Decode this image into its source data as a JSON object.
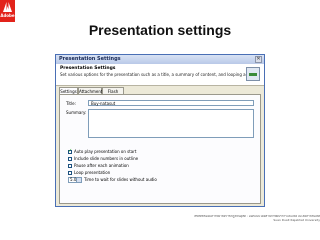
{
  "brand": {
    "logo_text": "Adobe",
    "color": "#e2231a"
  },
  "page": {
    "title": "Presentation settings"
  },
  "dialog": {
    "window_title": "Presentation Settings",
    "close_symbol": "✕",
    "header_title": "Presentation Settings",
    "header_subtitle": "Set various options for the presentation such as a title, a summary of content, and looping action.",
    "tabs": [
      {
        "label": "Settings"
      },
      {
        "label": "Attachments"
      },
      {
        "label": "Flash Files"
      }
    ],
    "title_label": "Title:",
    "title_value": "Buy-natasut",
    "summary_label": "Summary:",
    "summary_value": "",
    "options": [
      {
        "label": "Auto play presentation on start",
        "checked": true
      },
      {
        "label": "Include slide numbers in outline",
        "checked": false
      },
      {
        "label": "Pause after each animation",
        "checked": false
      },
      {
        "label": "Loop presentation",
        "checked": false
      }
    ],
    "wait_value": "5.0",
    "wait_label": "Time to wait for slides without audio"
  },
  "footer": {
    "line1": "ลิขสิทธิ์ของมหาวิทยาลัยราชภัฏสวนดุสิต : ออกแบบโดยสำนักวิทยบริการและเทคโนโลยีสารสนเทศ",
    "line2": "Suan Dusit Rajabhat University"
  }
}
